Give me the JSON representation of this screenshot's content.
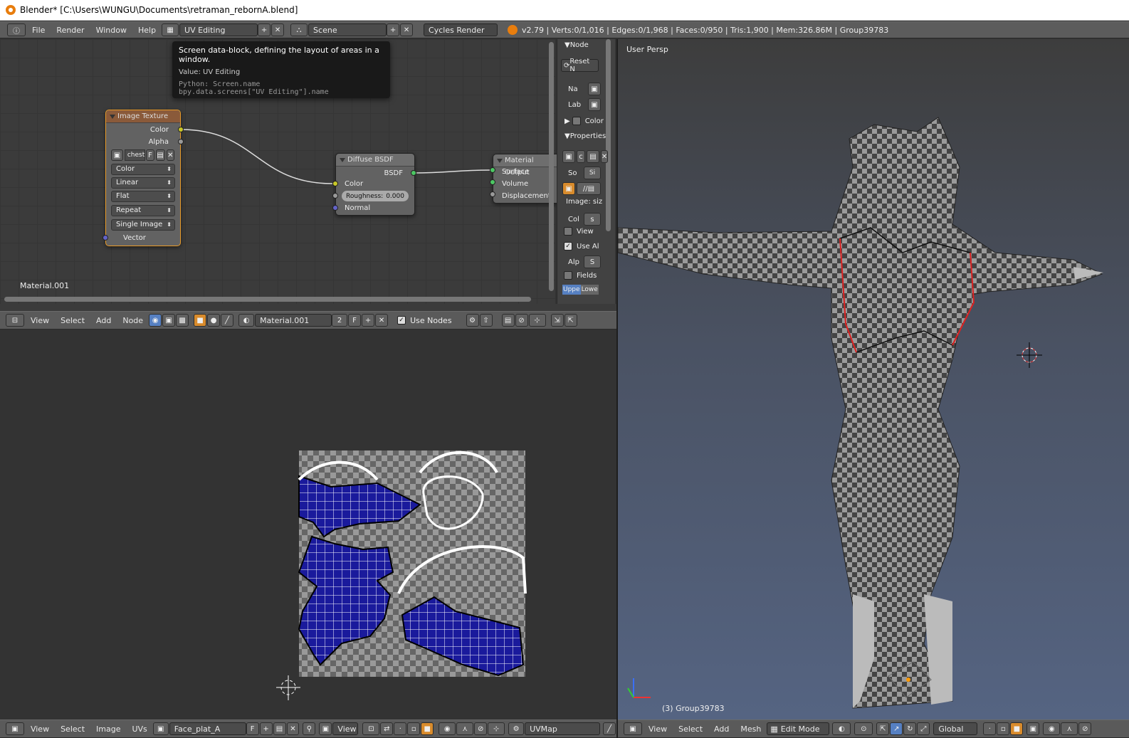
{
  "window_title": "Blender* [C:\\Users\\WUNGU\\Documents\\retraman_rebornA.blend]",
  "info_header": {
    "menus": [
      "File",
      "Render",
      "Window",
      "Help"
    ],
    "screen_layout": "UV Editing",
    "scene": "Scene",
    "render_engine": "Cycles Render",
    "stats": "v2.79 | Verts:0/1,016 | Edges:0/1,968 | Faces:0/950 | Tris:1,900 | Mem:326.86M | Group39783"
  },
  "tooltip": {
    "title": "Screen data-block, defining the layout of areas in a window.",
    "value": "Value: UV Editing",
    "python1": "Python: Screen.name",
    "python2": "bpy.data.screens[\"UV Editing\"].name"
  },
  "node_editor": {
    "material_label": "Material.001",
    "image_texture": {
      "title": "Image Texture",
      "out_color": "Color",
      "out_alpha": "Alpha",
      "image_name": "chest",
      "fake_btn": "F",
      "color_mode": "Color",
      "interpolation": "Linear",
      "projection": "Flat",
      "extension": "Repeat",
      "source": "Single Image",
      "in_vector": "Vector"
    },
    "diffuse": {
      "title": "Diffuse BSDF",
      "out_bsdf": "BSDF",
      "in_color": "Color",
      "roughness": "Roughness:",
      "roughness_value": "0.000",
      "in_normal": "Normal"
    },
    "output": {
      "title": "Material Output",
      "surface": "Surface",
      "volume": "Volume",
      "displacement": "Displacement"
    },
    "header": {
      "menus": [
        "View",
        "Select",
        "Add",
        "Node"
      ],
      "material": "Material.001",
      "users": "2",
      "fake": "F",
      "use_nodes_label": "Use Nodes"
    }
  },
  "n_panel": {
    "node_section": "Node",
    "reset_btn": "Reset N",
    "name_label": "Na",
    "label_label": "Lab",
    "color_section": "Color",
    "properties_section": "Properties",
    "image_field": "c",
    "source_label": "So",
    "source_value": "Si",
    "image_size": "Image: siz",
    "color_label": "Col",
    "color_value": "s",
    "view_label": "View",
    "use_alpha_label": "Use Al",
    "alpha_label": "Alp",
    "alpha_value": "S",
    "fields_label": "Fields",
    "upper": "Uppe",
    "lower": "Lowe"
  },
  "uv_editor": {
    "header": {
      "menus": [
        "View",
        "Select",
        "Image",
        "UVs"
      ],
      "image_name": "Face_plat_A",
      "fake": "F",
      "view_mode": "View",
      "uvmap": "UVMap"
    }
  },
  "viewport": {
    "label": "User Persp",
    "object_info": "(3) Group39783",
    "header": {
      "menus": [
        "View",
        "Select",
        "Add",
        "Mesh"
      ],
      "mode": "Edit Mode",
      "orientation": "Global"
    }
  }
}
